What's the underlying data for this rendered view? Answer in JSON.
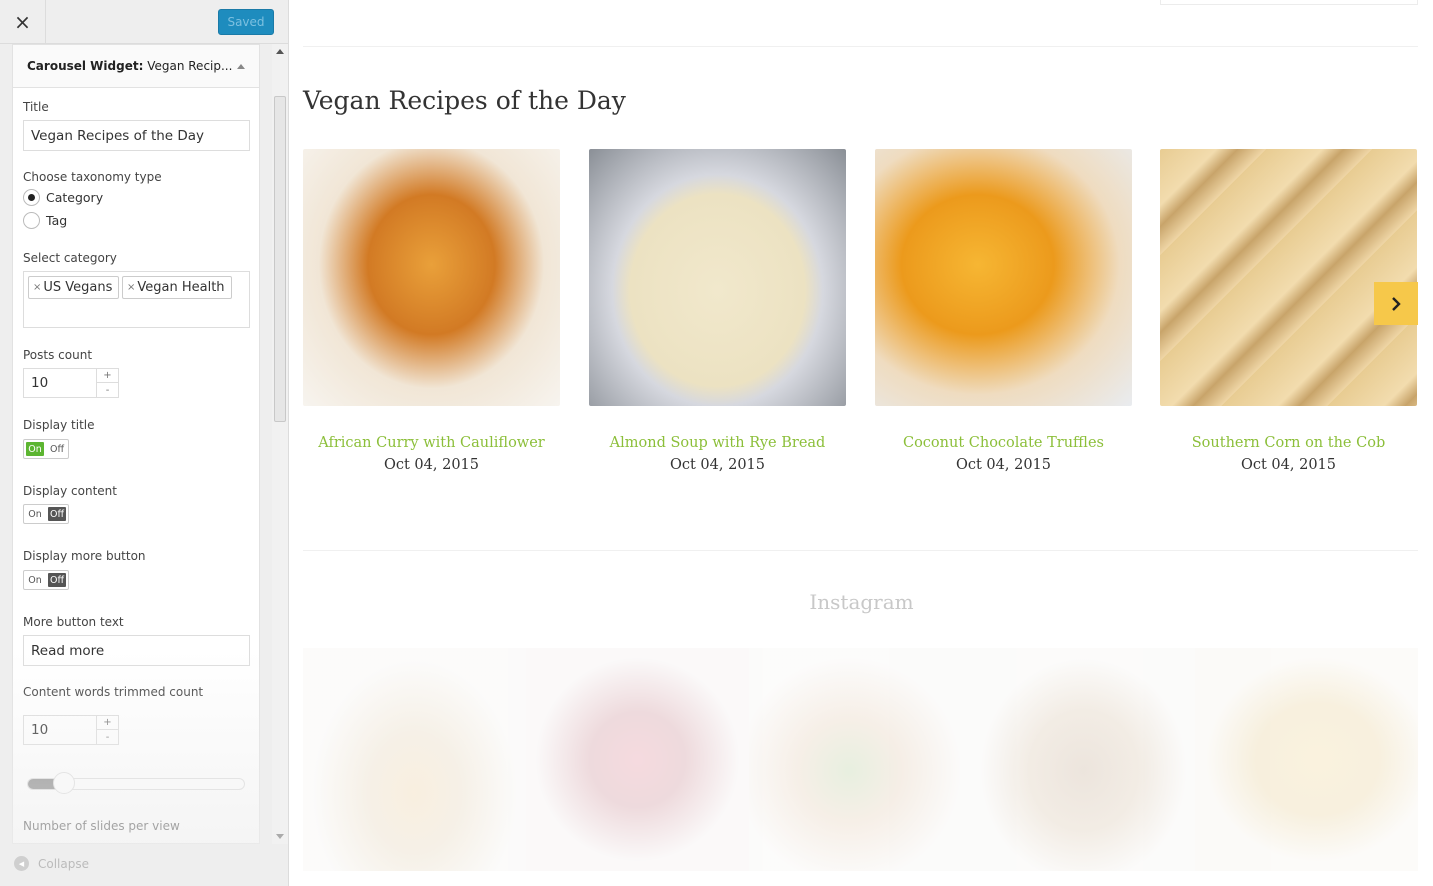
{
  "header": {
    "close_icon": "×",
    "saved_label": "Saved"
  },
  "widget": {
    "name_bold": "Carousel Widget:",
    "name_rest": " Vegan Recip...",
    "title_label": "Title",
    "title_value": "Vegan Recipes of the Day",
    "taxonomy_label": "Choose taxonomy type",
    "taxonomy_options": [
      "Category",
      "Tag"
    ],
    "taxonomy_selected": "Category",
    "category_label": "Select category",
    "categories": [
      "US Vegans",
      "Vegan Health"
    ],
    "chip_remove": "×",
    "posts_count_label": "Posts count",
    "posts_count": "10",
    "plus": "+",
    "minus": "-",
    "display_title_label": "Display title",
    "display_title": "On",
    "display_content_label": "Display content",
    "display_content": "Off",
    "display_more_label": "Display more button",
    "display_more": "Off",
    "on_label": "On",
    "off_label": "Off",
    "more_text_label": "More button text",
    "more_text_value": "Read more",
    "trim_label": "Content words trimmed count",
    "trim_value": "10",
    "slides_label": "Number of slides per view"
  },
  "collapse_label": "Collapse",
  "section": {
    "title": "Vegan Recipes of the Day",
    "posts": [
      {
        "name": "African Curry with Cauliflower",
        "date": "Oct 04, 2015",
        "image": "curry-photo"
      },
      {
        "name": "Almond Soup with Rye Bread",
        "date": "Oct 04, 2015",
        "image": "soup-photo"
      },
      {
        "name": "Coconut Chocolate Truffles",
        "date": "Oct 04, 2015",
        "image": "pie-photo"
      },
      {
        "name": "Southern Corn on the Cob",
        "date": "Oct 04, 2015",
        "image": "biscotti-photo"
      }
    ]
  },
  "instagram": {
    "title": "Instagram"
  },
  "colors": {
    "accent_green": "#8cbf3a",
    "next_yellow": "#f6c84a",
    "saved_blue": "#1e8cbe"
  }
}
